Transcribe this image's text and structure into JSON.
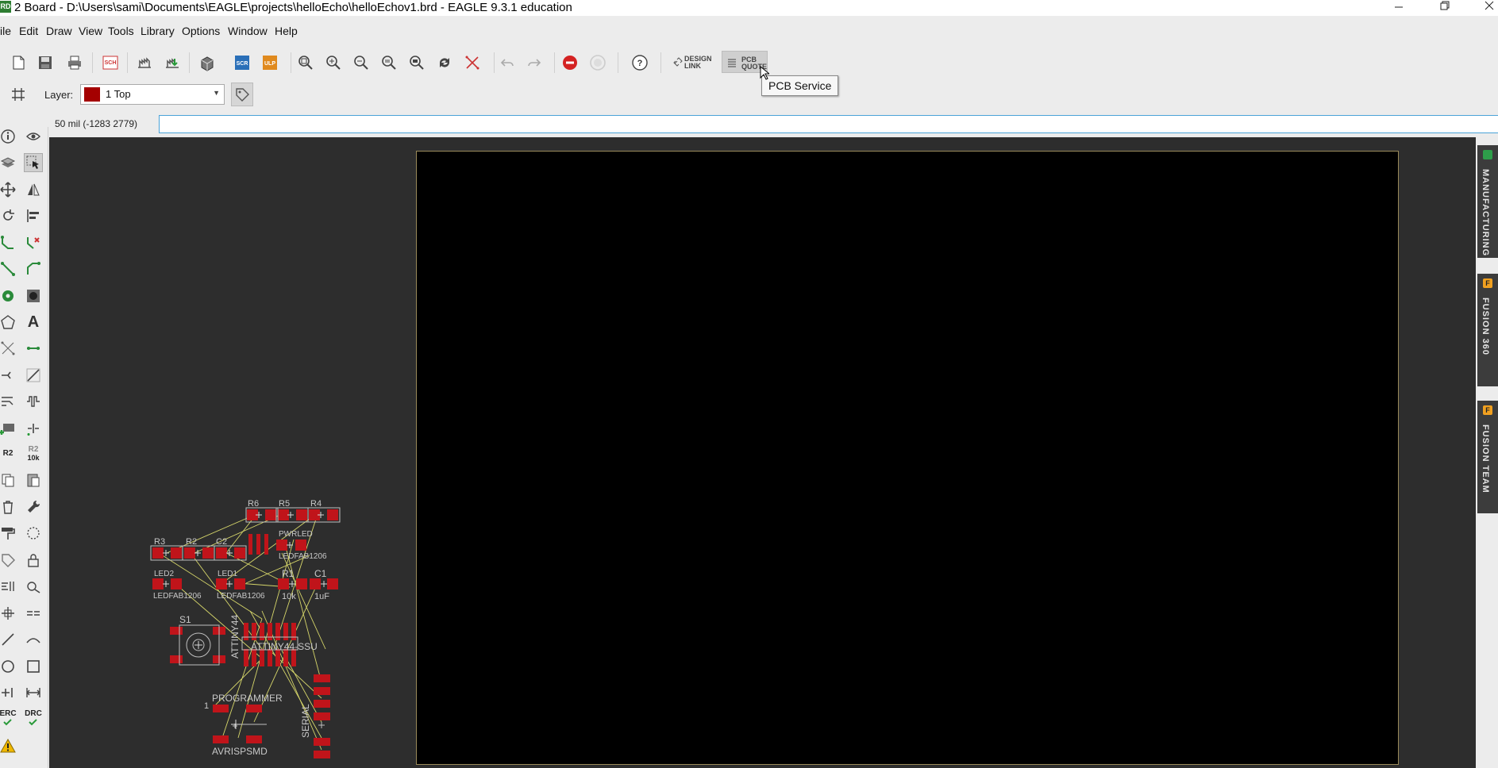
{
  "window": {
    "title": "2 Board - D:\\Users\\sami\\Documents\\EAGLE\\projects\\helloEcho\\helloEchov1.brd - EAGLE 9.3.1 education",
    "app_icon": "RD",
    "controls": [
      "minimize-icon",
      "restore-icon",
      "close-icon"
    ]
  },
  "menu": {
    "items": [
      "File",
      "Edit",
      "Draw",
      "View",
      "Tools",
      "Library",
      "Options",
      "Window",
      "Help"
    ],
    "file_label": "ile"
  },
  "toolbar": {
    "icons": [
      "new-icon",
      "save-icon",
      "print-icon",
      "sch-icon",
      "cam-icon",
      "export-icon",
      "3d-package-icon",
      "scr-icon",
      "ulp-icon",
      "zoom-fit-icon",
      "zoom-in-icon",
      "zoom-out-icon",
      "zoom-select-icon",
      "zoom-area-icon",
      "redraw-icon",
      "ratsnest-icon",
      "undo-icon",
      "redo-icon",
      "stop-icon",
      "go-icon",
      "help-icon",
      "design-link-icon",
      "pcb-quote-icon"
    ],
    "sch_label": "SCH",
    "scr_label": "SCR",
    "ulp_label": "ULP",
    "design_link_line1": "DESIGN",
    "design_link_line2": "LINK",
    "pcb_quote_line1": "PCB",
    "pcb_quote_line2": "QUOTE",
    "help_label": "?",
    "tooltip": "PCB Service"
  },
  "layer": {
    "label": "Layer:",
    "value": "1 Top",
    "color": "#a40000"
  },
  "command": {
    "coordinates": "50 mil (-1283 2779)",
    "input_value": ""
  },
  "palette": {
    "r2_label": "R2",
    "r2_value": "10k",
    "erc_label": "ERC",
    "drc_label": "DRC",
    "text_tool": "A"
  },
  "side_panels": [
    {
      "label": "MANUFACTURING",
      "badge": "",
      "badge_color": "#2e9e4a"
    },
    {
      "label": "FUSION 360",
      "badge": "F",
      "badge_color": "#f0a020"
    },
    {
      "label": "FUSION TEAM",
      "badge": "F",
      "badge_color": "#f0a020"
    }
  ],
  "pcb": {
    "labels": {
      "r6": "R6",
      "r5": "R5",
      "r4": "R4",
      "r3": "R3",
      "r2": "R2",
      "c2": "C2",
      "pwrled": "PWRLED",
      "pwrled_pkg": "LEDFAB1206",
      "led2": "LED2",
      "led1": "LED1",
      "led2_pkg": "LEDFAB1206",
      "led1_pkg": "LEDFAB1206",
      "r1": "R1",
      "r1_val": "10k",
      "c1": "C1",
      "c1_val": "1uF",
      "s1": "S1",
      "u1_name": "ATTINY44",
      "u1_pkg": "ATTINY44-SSU",
      "programmer": "PROGRAMMER",
      "pin1": "1",
      "serial": "SERIAL",
      "avrisp": "AVRISPSMD"
    },
    "colors": {
      "pad": "#c0141a",
      "airwire": "#d6d66a",
      "outline": "#bfbfbf"
    }
  }
}
